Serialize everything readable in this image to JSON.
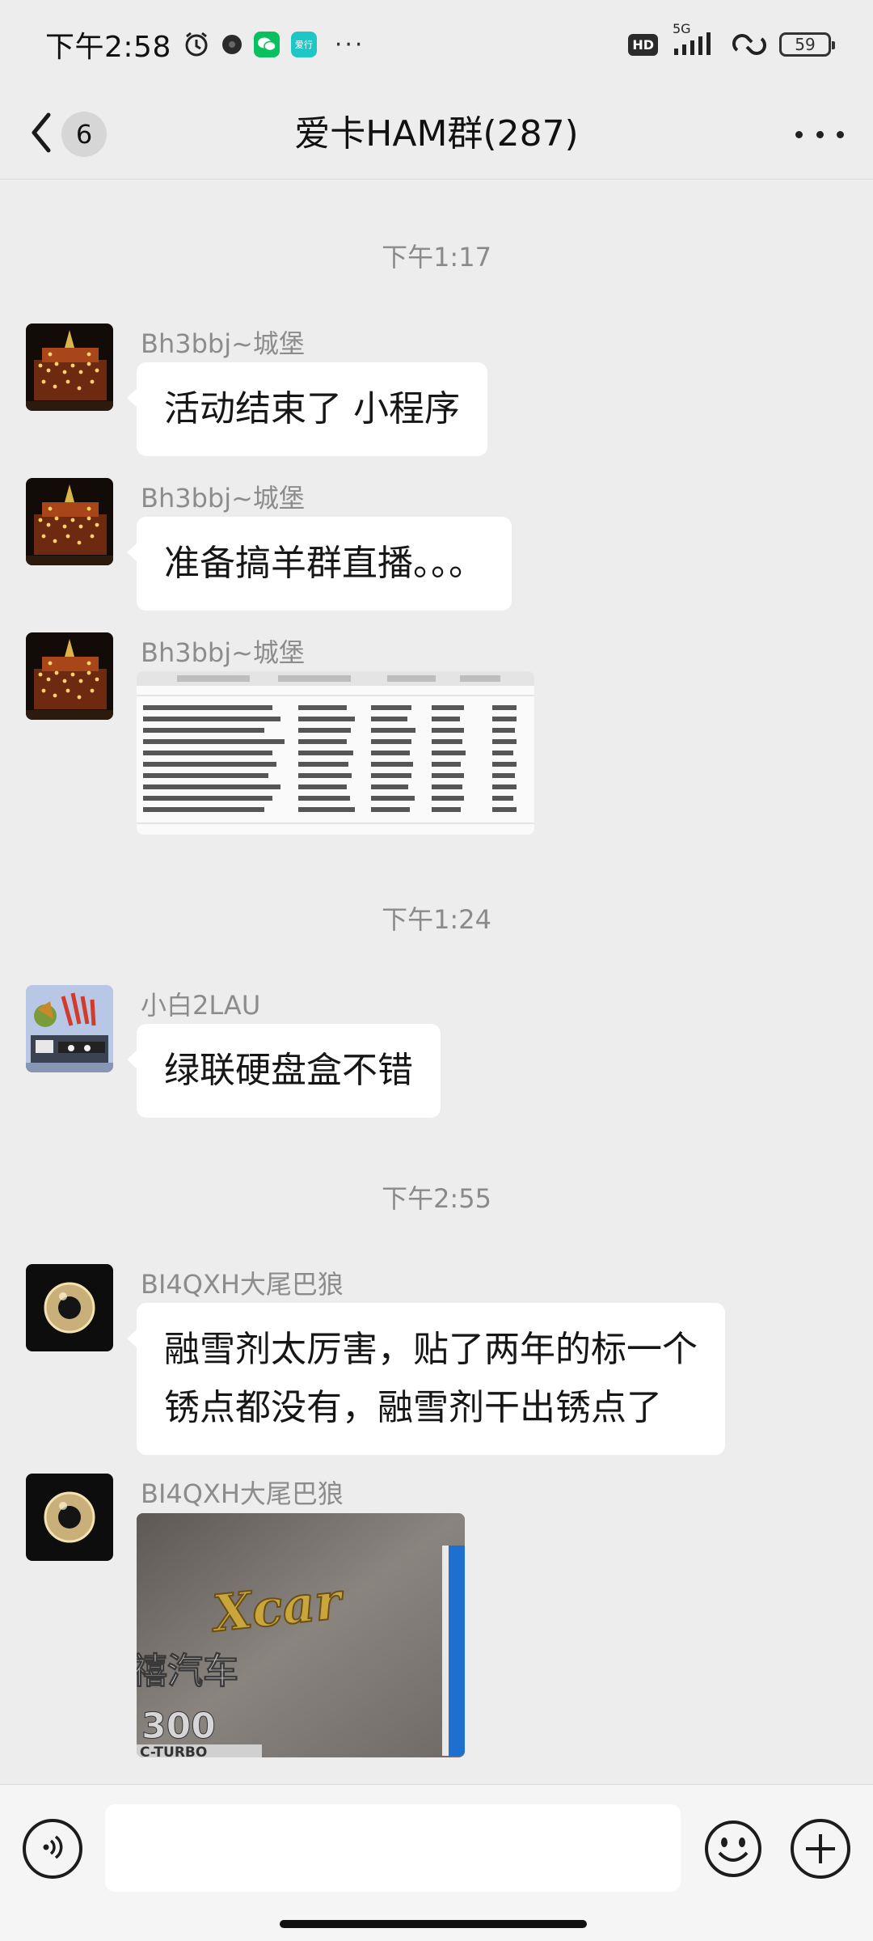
{
  "status_bar": {
    "time": "下午2:58",
    "app_badge_label": "爱行",
    "network": "5G",
    "battery": "59",
    "hd_label": "HD"
  },
  "nav": {
    "unread_count": "6",
    "title": "爱卡HAM群(287)"
  },
  "timestamps": [
    "下午1:17",
    "下午1:24",
    "下午2:55"
  ],
  "messages": [
    {
      "sender": "Bh3bbj~城堡",
      "type": "text",
      "text": "活动结束了  小程序"
    },
    {
      "sender": "Bh3bbj~城堡",
      "type": "text",
      "text": "准备搞羊群直播。。。"
    },
    {
      "sender": "Bh3bbj~城堡",
      "type": "image"
    },
    {
      "sender": "小白2LAU",
      "type": "text",
      "text": "绿联硬盘盒不错"
    },
    {
      "sender": "BI4QXH大尾巴狼",
      "type": "text",
      "text": "融雪剂太厉害，贴了两年的标一个\n锈点都没有，融雪剂干出锈点了"
    },
    {
      "sender": "BI4QXH大尾巴狼",
      "type": "image",
      "badge_text": "Xcar",
      "sign_text": "禧汽车",
      "model_text": "300",
      "turbo_text": "C-TURBO"
    }
  ],
  "input": {
    "placeholder": ""
  },
  "colors": {
    "background": "#ededed",
    "bubble": "#ffffff",
    "wechat_green": "#07c160",
    "timestamp": "#8a8a8a",
    "sender_name": "#8c8c8c"
  }
}
